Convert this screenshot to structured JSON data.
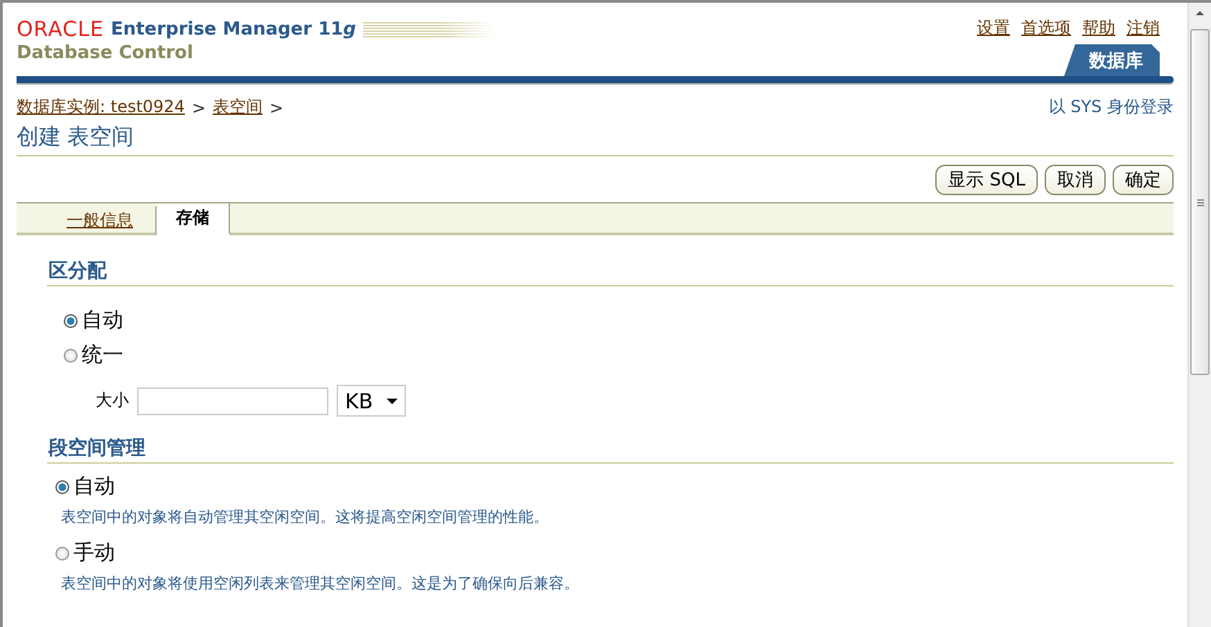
{
  "header": {
    "logo": "ORACLE",
    "product": "Enterprise Manager 11",
    "product_suffix": "g",
    "subtitle": "Database Control",
    "global_links": [
      "设置",
      "首选项",
      "帮助",
      "注销"
    ],
    "tabs": [
      {
        "label": "数据库",
        "selected": true
      }
    ]
  },
  "breadcrumb": [
    {
      "kind": "link",
      "label": "数据库实例: test0924"
    },
    {
      "kind": "separator",
      "label": ">"
    },
    {
      "kind": "link",
      "label": "表空间"
    },
    {
      "kind": "separator",
      "label": ">"
    }
  ],
  "login_info": "以 SYS 身份登录",
  "page_title": "创建 表空间",
  "buttons": [
    "显示 SQL",
    "取消",
    "确定"
  ],
  "subtabs": [
    {
      "label": "一般信息",
      "selected": false
    },
    {
      "label": "存储",
      "selected": true
    }
  ],
  "sections": [
    {
      "title": "区分配",
      "items": [
        {
          "kind": "radio",
          "label": "自动",
          "selected": true
        },
        {
          "kind": "radio",
          "label": "统一",
          "selected": false
        },
        {
          "kind": "size",
          "label": "大小",
          "unit": "KB"
        }
      ]
    },
    {
      "title": "段空间管理",
      "items": [
        {
          "kind": "radio",
          "label": "自动",
          "selected": true,
          "description": "表空间中的对象将自动管理其空闲空间。这将提高空闲空间管理的性能。"
        },
        {
          "kind": "radio",
          "label": "手动",
          "selected": false,
          "description": "表空间中的对象将使用空闲列表来管理其空闲空间。这是为了确保向后兼容。"
        }
      ]
    }
  ]
}
